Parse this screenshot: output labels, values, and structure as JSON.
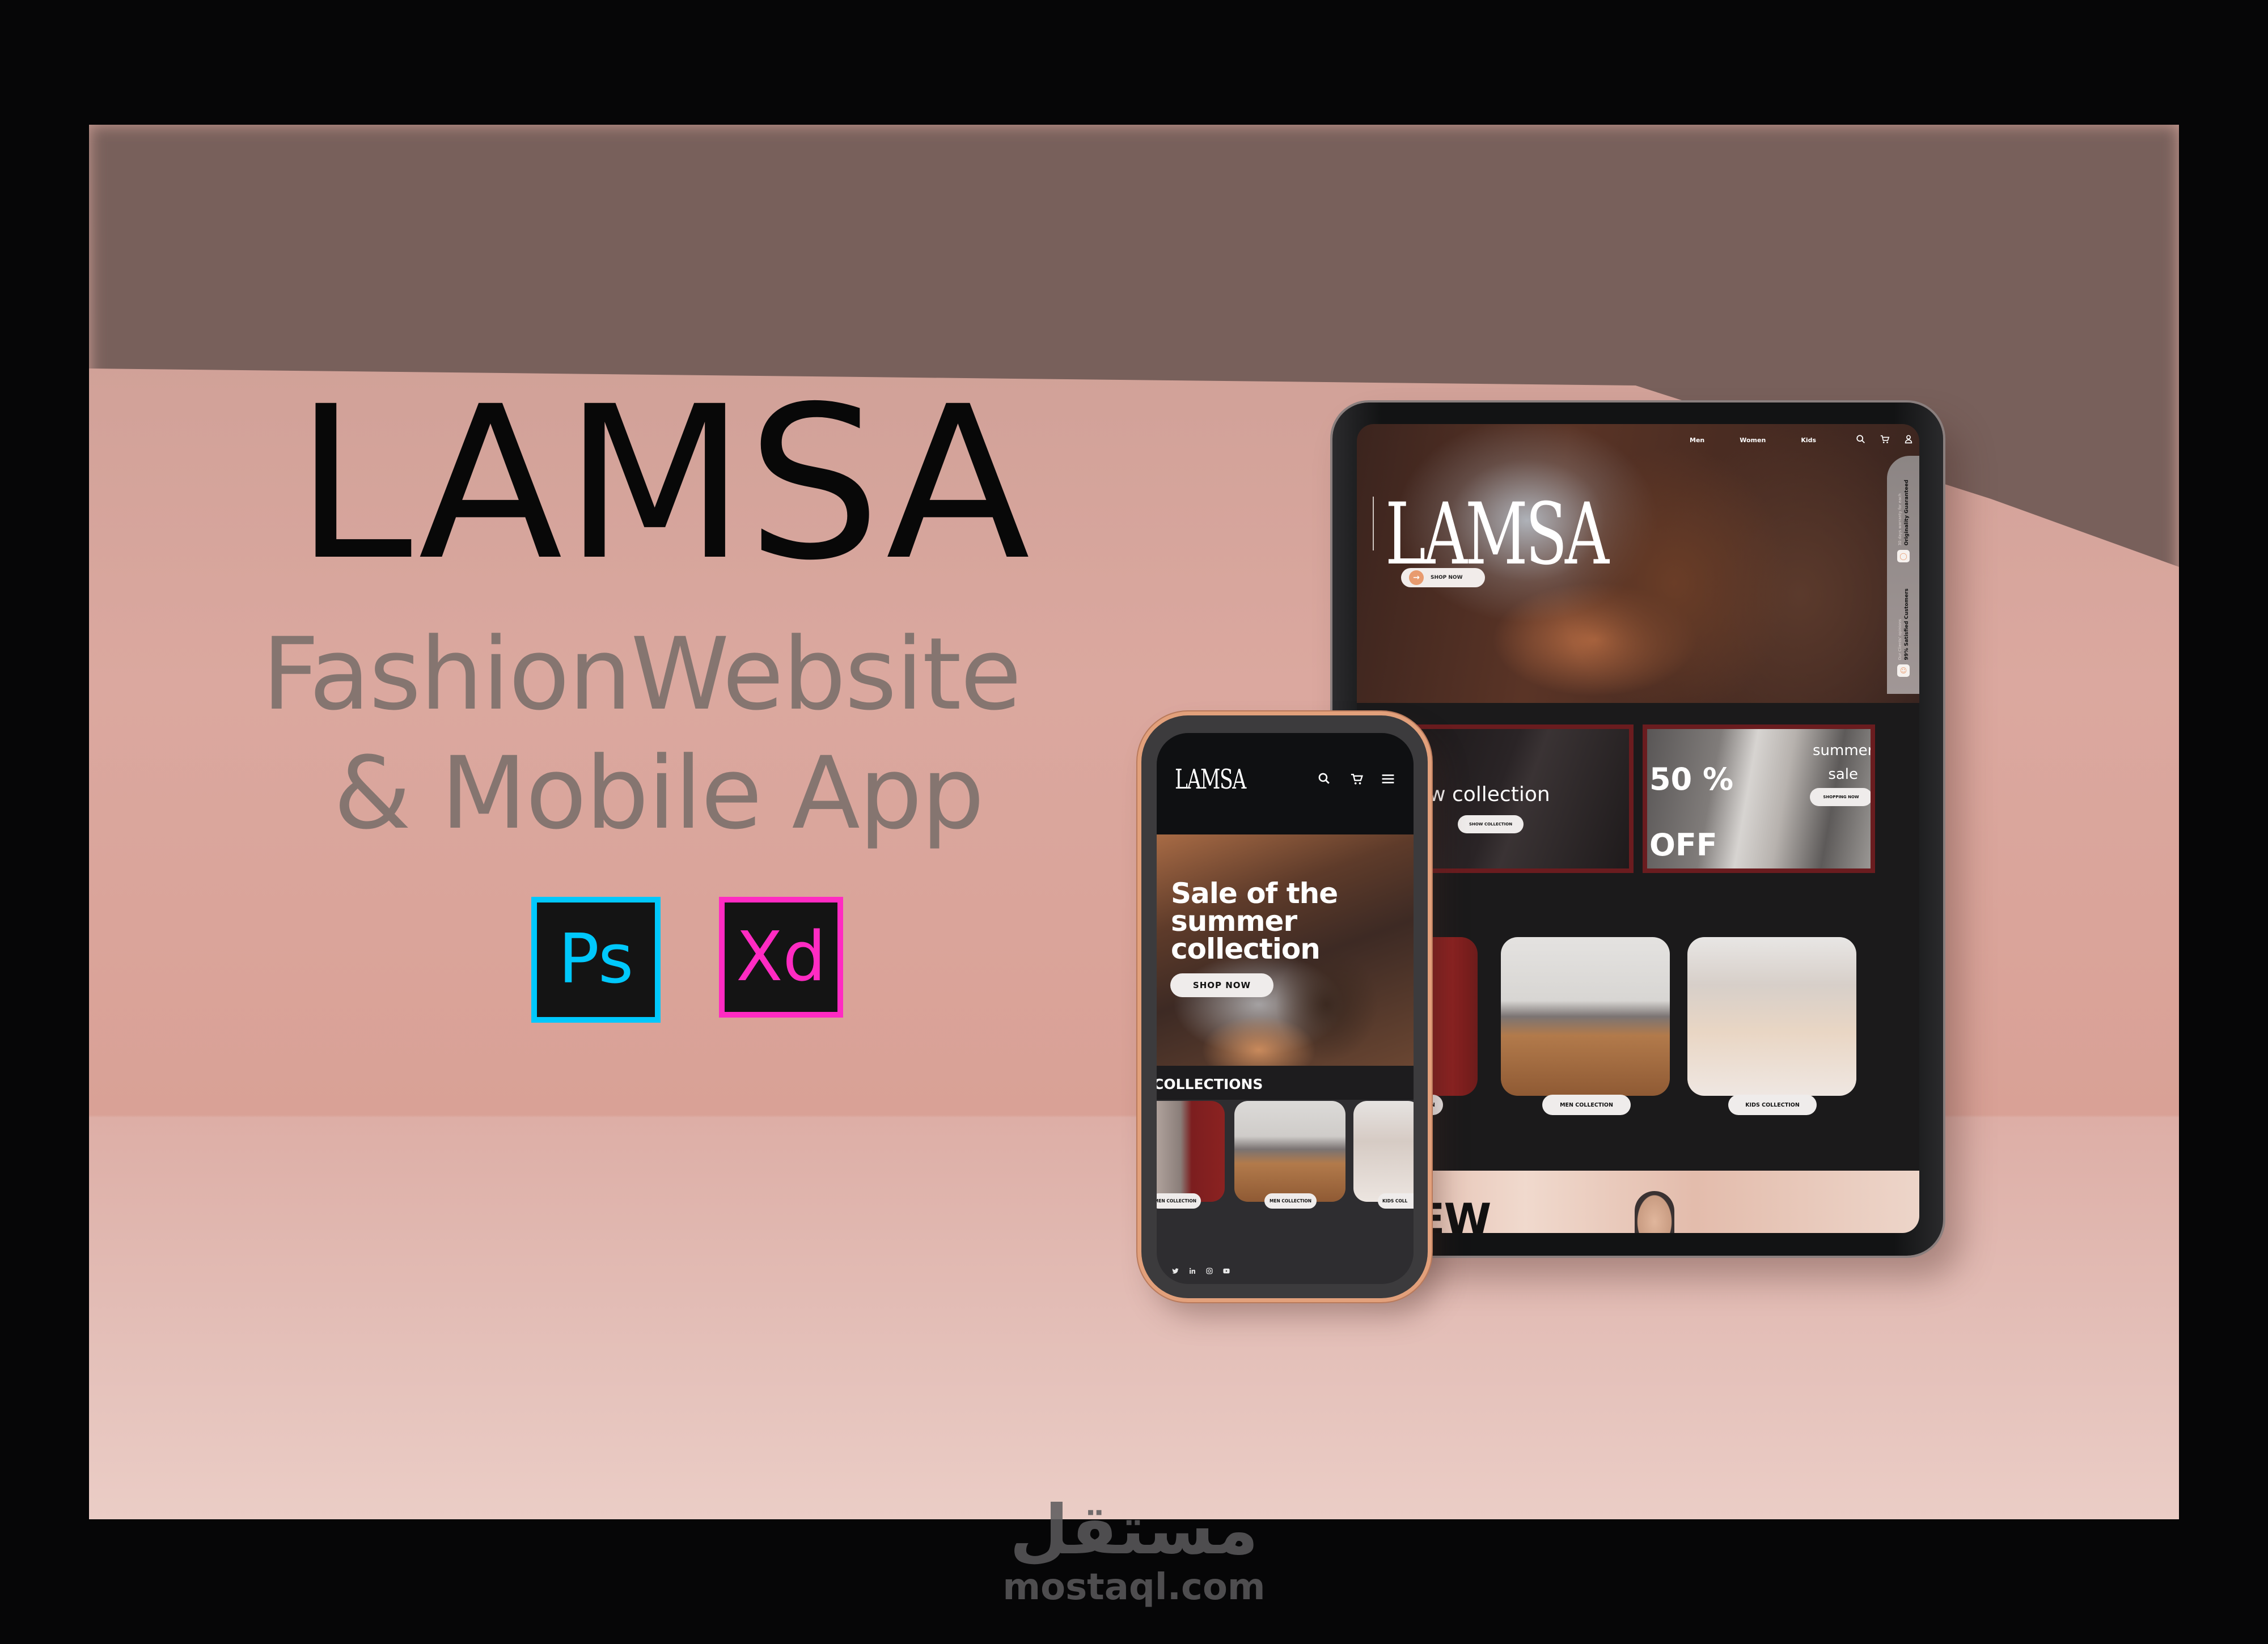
{
  "poster": {
    "title": "LAMSA",
    "subtitle_line1": "FashionWebsite",
    "subtitle_line2": "& Mobile App",
    "tools": [
      {
        "name": "photoshop",
        "label": "Ps",
        "color": "#00c8fc"
      },
      {
        "name": "xd",
        "label": "Xd",
        "color": "#ff2bc2"
      }
    ],
    "background_color": "#dba89f",
    "frame_color": "#060607"
  },
  "tablet": {
    "nav": {
      "links": [
        "Men",
        "Women",
        "Kids"
      ],
      "icons": [
        "search-icon",
        "cart-icon",
        "user-icon"
      ]
    },
    "hero": {
      "logo": "LAMSA",
      "cta_label": "SHOP NOW",
      "cta_icon": "arrow-right-icon",
      "accent_color": "#e89b6f"
    },
    "side_panel": [
      {
        "icon": "shield-icon",
        "title": "Originality Guaranteed",
        "subtitle": "30 days warranty for each"
      },
      {
        "icon": "smile-icon",
        "title": "99% Satisfied Customers",
        "subtitle": "Our Clients' opinions"
      }
    ],
    "promos": [
      {
        "title": "New collection",
        "button": "SHOW COLLECTION"
      },
      {
        "big_line1": "50 %",
        "big_line2": "OFF",
        "title_line1": "summer",
        "title_line2": "sale",
        "button": "SHOPPING NOW"
      }
    ],
    "promo_border_color": "#6a1c1f",
    "collections": [
      {
        "label": "WOMEN COLLECTION",
        "visible_label": "MEN COLLECTION"
      },
      {
        "label": "MEN COLLECTION"
      },
      {
        "label": "KIDS COLLECTION"
      }
    ],
    "new_section_title": "NEW"
  },
  "phone": {
    "header": {
      "logo": "LAMSA",
      "icons": [
        "search-icon",
        "cart-icon",
        "menu-icon"
      ]
    },
    "hero": {
      "title_line1": "Sale of the",
      "title_line2": "summer",
      "title_line3": "collection",
      "cta_label": "SHOP NOW"
    },
    "collections": {
      "title": "COLLECTIONS",
      "cards": [
        {
          "label": "WOMEN COLLECTION",
          "visible_label": "MEN COLLECTION"
        },
        {
          "label": "MEN COLLECTION"
        },
        {
          "label": "KIDS COLLECTION",
          "visible_label": "KIDS COLL"
        }
      ]
    },
    "social_icons": [
      "twitter-icon",
      "linkedin-icon",
      "instagram-icon",
      "youtube-icon"
    ]
  },
  "watermark": {
    "arabic": "مستقل",
    "domain": "mostaql.com"
  }
}
